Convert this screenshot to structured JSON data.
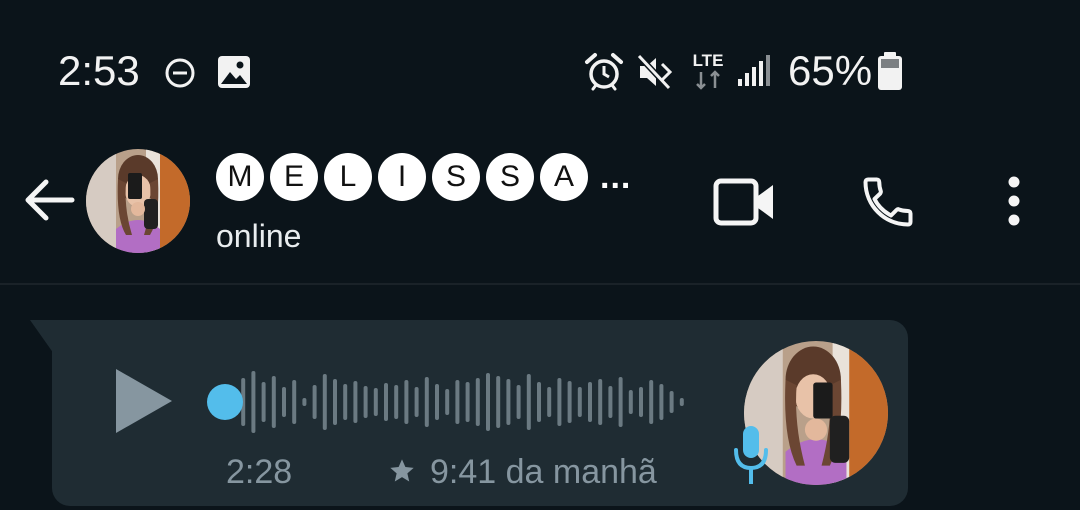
{
  "status_bar": {
    "time": "2:53",
    "network_type": "LTE",
    "battery_percent": "65%",
    "icons": [
      "dnd-icon",
      "image-icon",
      "alarm-icon",
      "mute-icon",
      "lte-icon",
      "signal-icon",
      "battery-icon"
    ]
  },
  "header": {
    "contact_name_letters": [
      "M",
      "E",
      "L",
      "I",
      "S",
      "S",
      "A"
    ],
    "contact_name_ellipsis": "...",
    "status": "online",
    "icons": [
      "back-arrow-icon",
      "video-call-icon",
      "phone-icon",
      "more-vert-icon"
    ]
  },
  "message": {
    "type": "voice",
    "duration": "2:28",
    "time": "9:41 da manhã",
    "starred": true,
    "progress": 0.0,
    "colors": {
      "bubble": "#1f2c33",
      "playhead": "#53bdeb",
      "waveform": "#6b7a82",
      "mic": "#53bdeb"
    }
  },
  "colors": {
    "background": "#0b141a",
    "text_primary": "#e9edef",
    "text_secondary": "#8696a0"
  }
}
